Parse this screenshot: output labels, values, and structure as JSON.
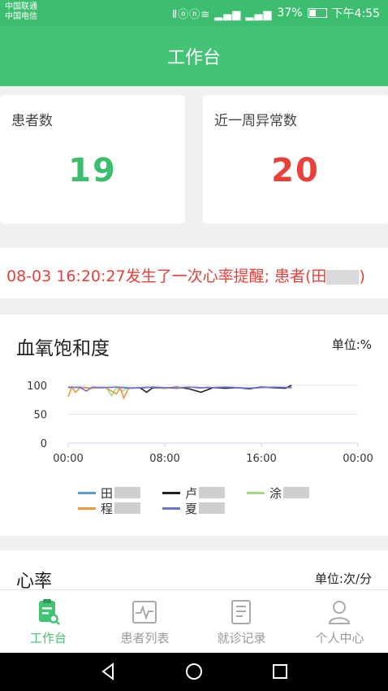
{
  "status_bar": {
    "carrier_1": "中国联通",
    "carrier_2": "中国电信",
    "icons": "Ⅱⓞⓝ≋ ▂▄▆ ▂▄▆",
    "battery": "37%",
    "time": "下午4:55"
  },
  "header": {
    "title": "工作台"
  },
  "stats": {
    "patients": {
      "label": "患者数",
      "value": "19",
      "color": "#3dbe6f"
    },
    "anomalies": {
      "label": "近一周异常数",
      "value": "20",
      "color": "#e8413b"
    }
  },
  "alert": {
    "text_prefix": "08-03 16:20:27发生了一次心率提醒; 患者(田",
    "text_suffix": ")"
  },
  "spo2_chart": {
    "title": "血氧饱和度",
    "unit": "单位:%",
    "legend": [
      {
        "label": "田",
        "color": "#5b9bd5"
      },
      {
        "label": "卢",
        "color": "#222222"
      },
      {
        "label": "涂",
        "color": "#9fdb87"
      },
      {
        "label": "程",
        "color": "#f0963c"
      },
      {
        "label": "夏",
        "color": "#6b73d8"
      }
    ]
  },
  "chart_data": {
    "type": "line",
    "title": "血氧饱和度",
    "ylabel": "单位:%",
    "x_ticks": [
      "00:00",
      "08:00",
      "16:00",
      "00:00"
    ],
    "y_ticks": [
      0,
      50,
      100
    ],
    "ylim": [
      0,
      100
    ],
    "xlim_hours": [
      0,
      24
    ],
    "series": [
      {
        "name": "田",
        "color": "#5b9bd5",
        "x": [
          0,
          1,
          2,
          3,
          4,
          5,
          6,
          7,
          8,
          9,
          10,
          11,
          12,
          13,
          14,
          15,
          16,
          17,
          18.5
        ],
        "values": [
          96,
          97,
          95,
          96,
          97,
          96,
          95,
          97,
          96,
          95,
          97,
          96,
          96,
          97,
          96,
          95,
          97,
          96,
          96
        ]
      },
      {
        "name": "卢",
        "color": "#222222",
        "x": [
          6,
          6.5,
          7,
          8,
          9,
          10,
          11,
          12,
          13,
          14,
          15,
          16,
          17,
          18,
          18.5
        ],
        "values": [
          95,
          88,
          96,
          95,
          97,
          94,
          88,
          96,
          95,
          96,
          94,
          97,
          96,
          95,
          100
        ]
      },
      {
        "name": "涂",
        "color": "#9fdb87",
        "x": [
          3.2,
          3.6,
          4,
          4.5,
          5,
          5.5
        ],
        "values": [
          95,
          82,
          96,
          90,
          97,
          94
        ]
      },
      {
        "name": "程",
        "color": "#f0963c",
        "x": [
          0,
          0.3,
          0.6,
          1,
          2,
          3,
          4,
          4.3,
          4.6,
          5,
          6,
          7,
          8,
          9,
          10,
          11,
          11.5,
          12,
          13
        ],
        "values": [
          80,
          97,
          88,
          96,
          95,
          97,
          85,
          96,
          78,
          95,
          96,
          97,
          95,
          96,
          97,
          95,
          97,
          96,
          97
        ]
      },
      {
        "name": "夏",
        "color": "#6b73d8",
        "x": [
          0,
          1,
          1.5,
          2,
          3,
          4,
          5,
          6,
          7,
          8,
          9,
          10,
          11,
          12,
          13,
          14,
          15,
          16,
          17,
          18.5
        ],
        "values": [
          97,
          96,
          90,
          97,
          96,
          97,
          95,
          96,
          97,
          96,
          95,
          97,
          96,
          96,
          97,
          96,
          95,
          96,
          97,
          96
        ]
      }
    ]
  },
  "heart_rate": {
    "title": "心率",
    "unit": "单位:次/分"
  },
  "tabs": [
    {
      "label": "工作台"
    },
    {
      "label": "患者列表"
    },
    {
      "label": "就诊记录"
    },
    {
      "label": "个人中心"
    }
  ]
}
